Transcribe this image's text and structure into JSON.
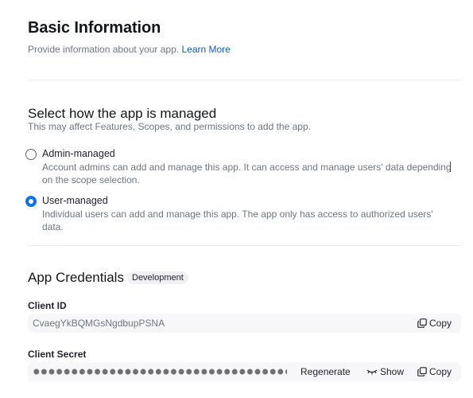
{
  "header": {
    "title": "Basic Information",
    "subtitle": "Provide information about your app.",
    "learn_more": "Learn More"
  },
  "management": {
    "title": "Select how the app is managed",
    "description": "This may affect Features, Scopes, and permissions to add the app.",
    "options": [
      {
        "label": "Admin-managed",
        "description": "Account admins can add and manage this app. It can access and manage users' data depending on the scope selection.",
        "selected": false
      },
      {
        "label": "User-managed",
        "description": "Individual users can add and manage this app. The app only has access to authorized users' data.",
        "selected": true
      }
    ]
  },
  "credentials": {
    "title": "App Credentials",
    "badge": "Development",
    "client_id": {
      "label": "Client ID",
      "value": "CvaegYkBQMGsNgdbupPSNA",
      "copy_label": "Copy"
    },
    "client_secret": {
      "label": "Client Secret",
      "regenerate_label": "Regenerate",
      "show_label": "Show",
      "copy_label": "Copy"
    }
  },
  "colors": {
    "accent": "#0e72ed",
    "link": "#0e5cc7",
    "muted_text": "#6e7680",
    "field_bg": "#f7f7fa"
  }
}
